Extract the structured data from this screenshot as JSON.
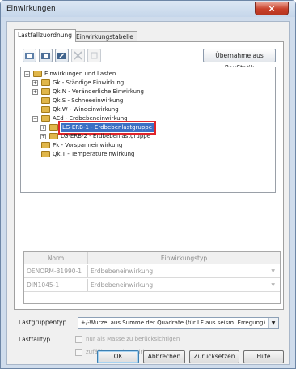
{
  "window": {
    "title": "Einwirkungen",
    "close_symbol": "×"
  },
  "tabs": [
    {
      "label": "Lastfallzuordnung",
      "active": true
    },
    {
      "label": "Einwirkungstabelle",
      "active": false
    }
  ],
  "toolbar": {
    "buttons": [
      {
        "icon": "new-action-icon",
        "enabled": true
      },
      {
        "icon": "new-group-icon",
        "enabled": true
      },
      {
        "icon": "edit-icon",
        "enabled": true
      },
      {
        "icon": "delete-icon",
        "enabled": false
      },
      {
        "icon": "move-icon",
        "enabled": false
      }
    ],
    "uebernahme_label": "Übernahme aus BauStatik"
  },
  "tree": {
    "nodes": [
      {
        "label": "Einwirkungen und Lasten",
        "level": 0,
        "expander": "−"
      },
      {
        "label": "Gk - Ständige Einwirkung",
        "level": 1,
        "expander": "+"
      },
      {
        "label": "Qk.N - Veränderliche Einwirkung",
        "level": 1,
        "expander": "+"
      },
      {
        "label": "Qk.S - Schneeeinwirkung",
        "level": 1,
        "expander": ""
      },
      {
        "label": "Qk.W - Windeinwirkung",
        "level": 1,
        "expander": ""
      },
      {
        "label": "AEd - Erdbebeneinwirkung",
        "level": 1,
        "expander": "−"
      },
      {
        "label": "LG-ERB-1 - Erdbebenlastgruppe",
        "level": 2,
        "expander": "+",
        "selected": true
      },
      {
        "label": "LG-ERB-2 - Erdbebenlastgruppe",
        "level": 2,
        "expander": "+"
      },
      {
        "label": "Pk - Vorspanneinwirkung",
        "level": 1,
        "expander": ""
      },
      {
        "label": "Qk.T - Temperatureinwirkung",
        "level": 1,
        "expander": ""
      }
    ]
  },
  "grid": {
    "columns": [
      "Norm",
      "Einwirkungstyp"
    ],
    "rows": [
      {
        "norm": "OENORM-B1990-1",
        "typ": "Erdbebeneinwirkung"
      },
      {
        "norm": "DIN1045-1",
        "typ": "Erdbebeneinwirkung"
      }
    ]
  },
  "form": {
    "lastgruppentyp_label": "Lastgruppentyp",
    "lastgruppentyp_value": "+/-Wurzel aus Summe der Quadrate (für LF aus seism. Erregung)",
    "lastfalltyp_label": "Lastfalltyp",
    "check_masse": "nur als Masse zu berücksichtigen",
    "check_torsion": "zufällige Torsionswirkung"
  },
  "buttons": {
    "ok": "OK",
    "abbrechen": "Abbrechen",
    "zuruecksetzen": "Zurücksetzen",
    "hilfe": "Hilfe"
  },
  "colors": {
    "selection": "#3b6fc4",
    "highlight_outline": "#e0242a",
    "close_button": "#c8402a"
  }
}
